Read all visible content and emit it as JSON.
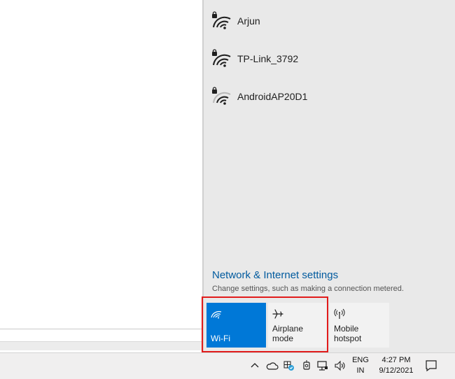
{
  "wifi_networks": [
    {
      "name": "Arjun",
      "icon": "wifi-lock-icon"
    },
    {
      "name": "TP-Link_3792",
      "icon": "wifi-lock-icon"
    },
    {
      "name": "AndroidAP20D1",
      "icon": "wifi-lock-icon"
    }
  ],
  "settings": {
    "link": "Network & Internet settings",
    "description": "Change settings, such as making a connection metered."
  },
  "quick_actions": [
    {
      "label": "Wi-Fi",
      "icon": "wifi-icon",
      "active": true
    },
    {
      "label": "Airplane mode",
      "icon": "airplane-icon",
      "active": false
    },
    {
      "label": "Mobile hotspot",
      "icon": "hotspot-icon",
      "active": false
    }
  ],
  "taskbar": {
    "tray_icons": [
      "chevron-up-icon",
      "cloud-icon",
      "security-icon",
      "camera-icon",
      "network-icon",
      "volume-icon",
      "notification-icon"
    ],
    "language": {
      "line1": "ENG",
      "line2": "IN"
    },
    "clock": {
      "time": "4:27 PM",
      "date": "9/12/2021"
    }
  },
  "colors": {
    "accent": "#0078d7",
    "link": "#005a9e",
    "highlight": "#e11b1b"
  }
}
